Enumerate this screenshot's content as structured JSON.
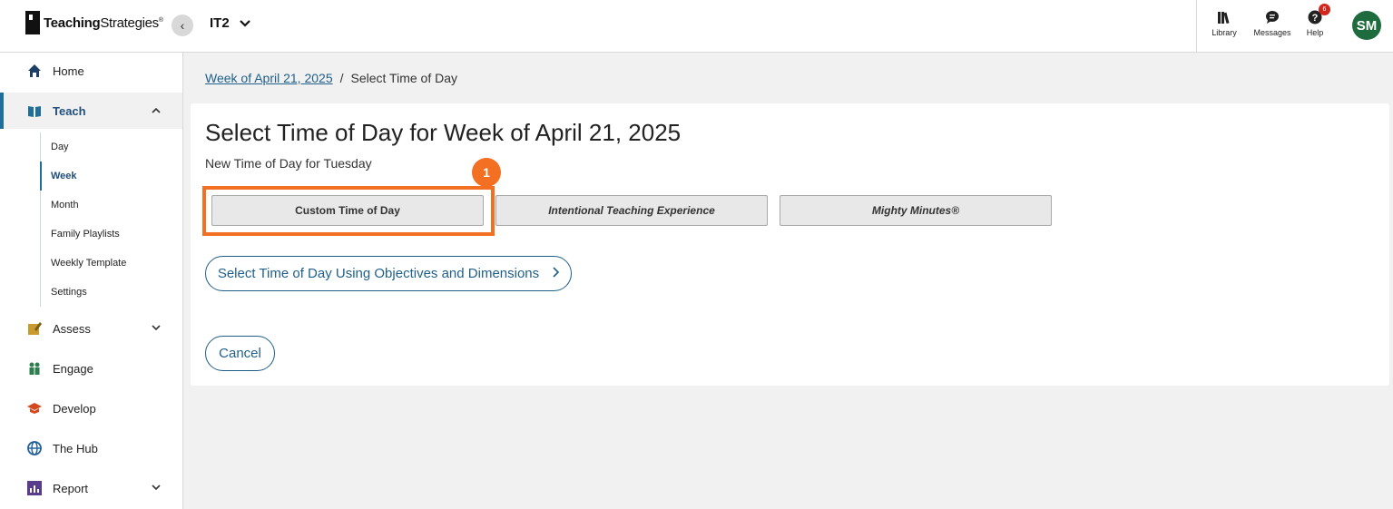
{
  "brand": {
    "bold": "Teaching",
    "light": "Strategies",
    "mark": "®"
  },
  "header": {
    "collapse_icon": "‹",
    "class_name": "IT2",
    "class_caret": "⌄",
    "icons": [
      {
        "name": "library-icon",
        "label": "Library"
      },
      {
        "name": "messages-icon",
        "label": "Messages"
      },
      {
        "name": "help-icon",
        "label": "Help",
        "badge": "6"
      }
    ],
    "avatar_initials": "SM"
  },
  "sidebar": {
    "items": [
      {
        "label": "Home",
        "icon": "home-icon"
      },
      {
        "label": "Teach",
        "icon": "book-icon",
        "caret": "^"
      },
      {
        "label": "Assess",
        "icon": "pencil-icon",
        "caret": "⌄"
      },
      {
        "label": "Engage",
        "icon": "people-icon"
      },
      {
        "label": "Develop",
        "icon": "graduation-cap-icon"
      },
      {
        "label": "The Hub",
        "icon": "globe-icon"
      },
      {
        "label": "Report",
        "icon": "bar-chart-icon",
        "caret": "⌄"
      }
    ],
    "teach_sub": [
      "Day",
      "Week",
      "Month",
      "Family Playlists",
      "Weekly Template",
      "Settings"
    ]
  },
  "breadcrumb": {
    "link": "Week of April 21, 2025",
    "separator": "/",
    "current": "Select Time of Day"
  },
  "main": {
    "title": "Select Time of Day for Week of April 21, 2025",
    "subtitle": "New Time of Day for Tuesday",
    "tod_buttons": [
      "Custom Time of Day",
      "Intentional Teaching Experience",
      "Mighty Minutes®"
    ],
    "step_number": "1",
    "objectives_button": "Select Time of Day Using Objectives and Dimensions",
    "objectives_chevron": "›",
    "cancel_button": "Cancel"
  },
  "colors": {
    "accent": "#1f5f8a",
    "highlight": "#f36f21",
    "avatar": "#1e6b3e"
  }
}
